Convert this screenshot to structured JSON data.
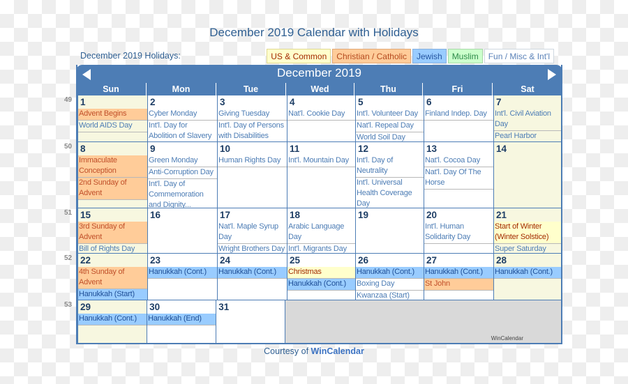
{
  "page": {
    "title": "December 2019 Calendar with Holidays",
    "holidays_label": "December 2019 Holidays:",
    "courtesy_prefix": "Courtesy of ",
    "courtesy_link": "WinCalendar"
  },
  "legend": [
    {
      "label": "US & Common",
      "category": "us"
    },
    {
      "label": "Christian / Catholic",
      "category": "christian"
    },
    {
      "label": "Jewish",
      "category": "jewish"
    },
    {
      "label": "Muslim",
      "category": "muslim"
    },
    {
      "label": "Fun / Misc & Int'l",
      "category": "fun"
    }
  ],
  "colors": {
    "header": "#4d7db5",
    "us": "#ffffcc",
    "christian": "#ffcc99",
    "jewish": "#99ccff",
    "muslim": "#ccffcc",
    "weekend": "#f7f7e0",
    "empty": "#d9d9d9"
  },
  "calendar": {
    "month_title": "December 2019",
    "prev_icon": "triangle-left",
    "next_icon": "triangle-right",
    "weekdays": [
      "Sun",
      "Mon",
      "Tue",
      "Wed",
      "Thu",
      "Fri",
      "Sat"
    ],
    "watermark": "WinCalendar",
    "weeks": [
      {
        "week_number": "49",
        "days": [
          {
            "day": "1",
            "weekend": true,
            "events": [
              {
                "name": "Advent Begins",
                "category": "christian"
              },
              {
                "name": "World AIDS Day",
                "category": "fun"
              }
            ]
          },
          {
            "day": "2",
            "events": [
              {
                "name": "Cyber Monday",
                "category": "fun"
              },
              {
                "name": "Int'l. Day for Abolition of Slavery",
                "category": "fun"
              }
            ]
          },
          {
            "day": "3",
            "events": [
              {
                "name": "Giving Tuesday",
                "category": "fun"
              },
              {
                "name": "Int'l. Day of Persons with Disabilities",
                "category": "fun"
              }
            ]
          },
          {
            "day": "4",
            "events": [
              {
                "name": "Nat'l. Cookie Day",
                "category": "fun"
              }
            ]
          },
          {
            "day": "5",
            "events": [
              {
                "name": "Int'l. Volunteer Day",
                "category": "fun"
              },
              {
                "name": "Nat'l. Repeal Day",
                "category": "fun"
              },
              {
                "name": "World Soil Day",
                "category": "fun"
              }
            ]
          },
          {
            "day": "6",
            "events": [
              {
                "name": "Finland Indep. Day",
                "category": "fun"
              }
            ]
          },
          {
            "day": "7",
            "weekend": true,
            "events": [
              {
                "name": "Int'l. Civil Aviation Day",
                "category": "fun"
              },
              {
                "name": "Pearl Harbor Remembrance",
                "category": "fun"
              }
            ]
          }
        ]
      },
      {
        "week_number": "50",
        "days": [
          {
            "day": "8",
            "weekend": true,
            "events": [
              {
                "name": "Immaculate Conception",
                "category": "christian"
              },
              {
                "name": "2nd Sunday of Advent",
                "category": "christian"
              }
            ]
          },
          {
            "day": "9",
            "events": [
              {
                "name": "Green Monday",
                "category": "fun"
              },
              {
                "name": "Anti-Corruption Day",
                "category": "fun"
              },
              {
                "name": "Int'l. Day of Commemoration and Dignity...",
                "category": "fun"
              }
            ]
          },
          {
            "day": "10",
            "events": [
              {
                "name": "Human Rights Day",
                "category": "fun"
              }
            ]
          },
          {
            "day": "11",
            "events": [
              {
                "name": "Int'l. Mountain Day",
                "category": "fun"
              }
            ]
          },
          {
            "day": "12",
            "events": [
              {
                "name": "Int'l. Day of Neutrality",
                "category": "fun"
              },
              {
                "name": "Int'l. Universal Health Coverage Day",
                "category": "fun"
              }
            ]
          },
          {
            "day": "13",
            "events": [
              {
                "name": "Nat'l. Cocoa Day",
                "category": "fun"
              },
              {
                "name": "Nat'l. Day Of The Horse",
                "category": "fun"
              }
            ]
          },
          {
            "day": "14",
            "weekend": true,
            "events": []
          }
        ]
      },
      {
        "week_number": "51",
        "days": [
          {
            "day": "15",
            "weekend": true,
            "events": [
              {
                "name": "3rd Sunday of Advent",
                "category": "christian"
              },
              {
                "name": "Bill of Rights Day",
                "category": "fun"
              }
            ]
          },
          {
            "day": "16",
            "events": []
          },
          {
            "day": "17",
            "events": [
              {
                "name": "Nat'l. Maple Syrup Day",
                "category": "fun"
              },
              {
                "name": "Wright Brothers Day",
                "category": "fun"
              }
            ]
          },
          {
            "day": "18",
            "events": [
              {
                "name": "Arabic Language Day",
                "category": "fun"
              },
              {
                "name": "Int'l. Migrants Day",
                "category": "fun"
              }
            ]
          },
          {
            "day": "19",
            "events": []
          },
          {
            "day": "20",
            "events": [
              {
                "name": "Int'l. Human Solidarity Day",
                "category": "fun"
              }
            ]
          },
          {
            "day": "21",
            "weekend": true,
            "events": [
              {
                "name": "Start of Winter (Winter Solstice)",
                "category": "us"
              },
              {
                "name": "Super Saturday",
                "category": "fun"
              }
            ]
          }
        ]
      },
      {
        "week_number": "52",
        "days": [
          {
            "day": "22",
            "weekend": true,
            "events": [
              {
                "name": "4th Sunday of Advent",
                "category": "christian"
              },
              {
                "name": "Hanukkah (Start)",
                "category": "jewish"
              }
            ]
          },
          {
            "day": "23",
            "events": [
              {
                "name": "Hanukkah (Cont.)",
                "category": "jewish"
              }
            ]
          },
          {
            "day": "24",
            "events": [
              {
                "name": "Hanukkah (Cont.)",
                "category": "jewish"
              }
            ]
          },
          {
            "day": "25",
            "events": [
              {
                "name": "Christmas",
                "category": "us"
              },
              {
                "name": "Hanukkah (Cont.)",
                "category": "jewish"
              }
            ]
          },
          {
            "day": "26",
            "events": [
              {
                "name": "Hanukkah (Cont.)",
                "category": "jewish"
              },
              {
                "name": "Boxing Day",
                "category": "fun"
              },
              {
                "name": "Kwanzaa (Start)",
                "category": "fun"
              }
            ]
          },
          {
            "day": "27",
            "events": [
              {
                "name": "Hanukkah (Cont.)",
                "category": "jewish"
              },
              {
                "name": "St John",
                "category": "christian"
              }
            ]
          },
          {
            "day": "28",
            "weekend": true,
            "events": [
              {
                "name": "Hanukkah (Cont.)",
                "category": "jewish"
              }
            ]
          }
        ]
      },
      {
        "week_number": "53",
        "days": [
          {
            "day": "29",
            "weekend": true,
            "events": [
              {
                "name": "Hanukkah (Cont.)",
                "category": "jewish"
              }
            ]
          },
          {
            "day": "30",
            "events": [
              {
                "name": "Hanukkah (End)",
                "category": "jewish"
              }
            ]
          },
          {
            "day": "31",
            "events": []
          }
        ]
      }
    ]
  }
}
